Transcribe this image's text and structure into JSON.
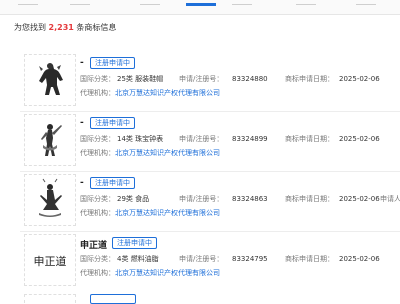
{
  "summary": {
    "prefix": "为您找到",
    "count": "2,231",
    "suffix": "条商标信息"
  },
  "labels": {
    "class": "国际分类：",
    "reg_no": "申请/注册号：",
    "date": "商标申请日期：",
    "agent": "代理机构："
  },
  "items": [
    {
      "name": "-",
      "status": "注册申请中",
      "class_value": "25类 服装鞋帽",
      "reg_no": "83324880",
      "date": "2025-02-06",
      "agent": "北京万慧达知识产权代理有限公司",
      "image": "warrior-figure"
    },
    {
      "name": "-",
      "status": "注册申请中",
      "class_value": "14类 珠宝钟表",
      "reg_no": "83324899",
      "date": "2025-02-06",
      "agent": "北京万慧达知识产权代理有限公司",
      "image": "dancer-figure"
    },
    {
      "name": "-",
      "status": "注册申请中",
      "class_value": "29类 食品",
      "reg_no": "83324863",
      "date": "2025-02-06",
      "agent": "北京万慧达知识产权代理有限公司",
      "extra_label": "申请人",
      "image": "meditating-figure"
    },
    {
      "name": "申正道",
      "status": "注册申请中",
      "class_value": "4类 燃料油脂",
      "reg_no": "83324795",
      "date": "2025-02-06",
      "agent": "北京万慧达知识产权代理有限公司",
      "image_text": "申正道"
    }
  ],
  "colors": {
    "accent": "#1e6fd9",
    "count": "#e4393c"
  }
}
